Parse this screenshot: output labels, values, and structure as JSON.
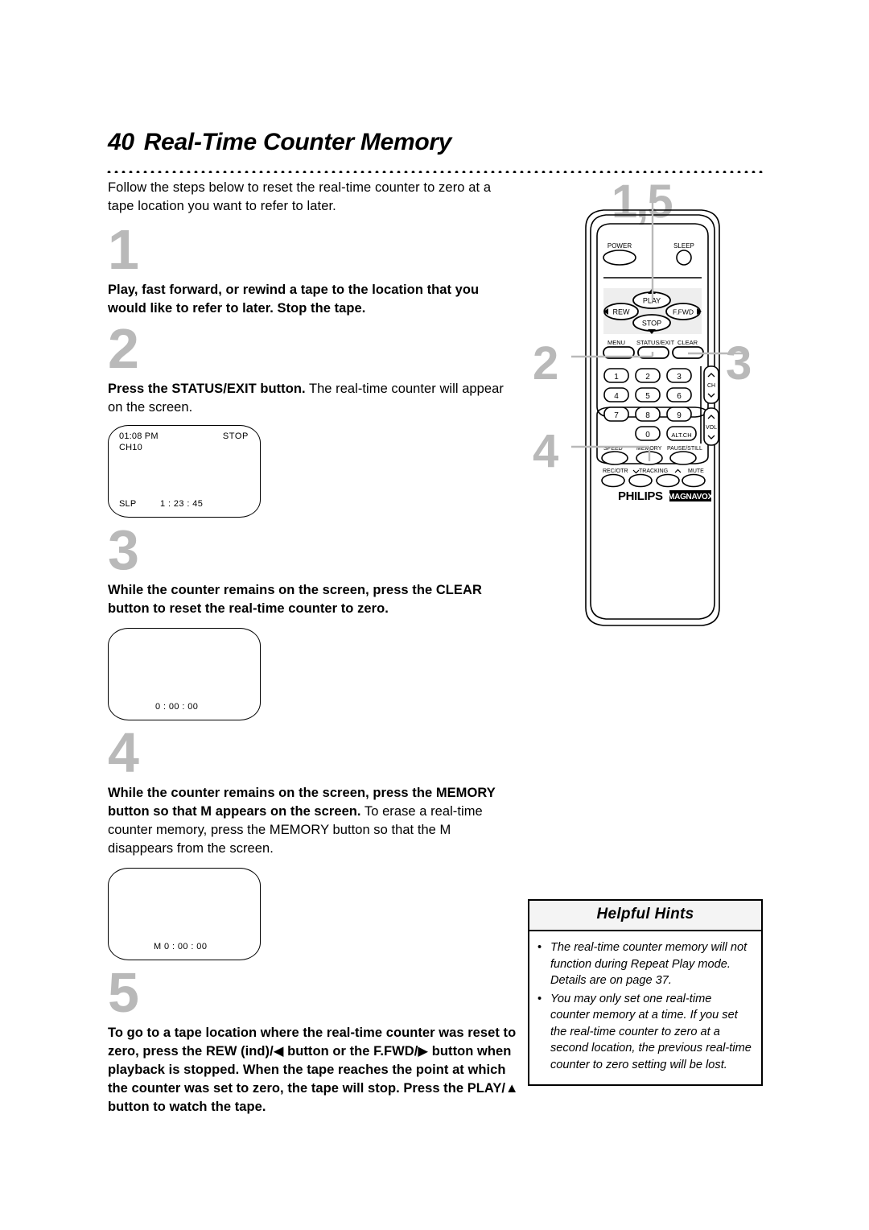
{
  "page": {
    "number": "40",
    "title": "Real-Time Counter Memory",
    "intro": "Follow the steps below to reset the real-time counter to zero at a tape location you want to refer to later."
  },
  "steps": [
    {
      "number": "1",
      "bold": "Play, fast forward, or rewind a tape to the location that you would like to refer to later.  Stop the tape.",
      "rest": ""
    },
    {
      "number": "2",
      "bold": "Press the STATUS/EXIT button.",
      "rest": " The real-time counter will appear on the screen."
    },
    {
      "number": "3",
      "bold": "While the counter remains on the screen, press the CLEAR button to reset the real-time counter to zero.",
      "rest": ""
    },
    {
      "number": "4",
      "bold": "While the counter remains on the screen, press the MEMORY button so that M appears on the screen.",
      "rest": " To erase a real-time counter memory, press the MEMORY button so that the M disappears from the screen."
    },
    {
      "number": "5",
      "bold": "To go to a tape location where the real-time counter was reset to zero, press the REW (ind)/◀ button or the F.FWD/▶ button when playback is stopped. When the tape reaches the point at which the counter was set to zero, the tape will stop. Press the PLAY/▲ button to watch the tape.",
      "rest": ""
    }
  ],
  "screens": {
    "step2": {
      "time": "01:08 PM",
      "mode": "STOP",
      "channel": "CH10",
      "speed": "SLP",
      "counter": "1 : 23 : 45"
    },
    "step3": {
      "counter": "0 : 00 : 00"
    },
    "step4": {
      "counter": "M  0 : 00 : 00"
    }
  },
  "hints": {
    "title": "Helpful Hints",
    "bullet": "•",
    "items": [
      "The real-time counter memory will not function during Repeat Play mode.  Details are on page 37.",
      "You may only set one real-time counter memory at a time. If you set the real-time counter to zero at a second location, the previous real-time counter to zero setting will be lost."
    ]
  },
  "remote": {
    "callouts": {
      "top": "1,5",
      "left_upper": "2",
      "right": "3",
      "left_lower": "4"
    },
    "buttons": {
      "power": "POWER",
      "sleep": "SLEEP",
      "play": "PLAY",
      "stop": "STOP",
      "rew": "REW",
      "ffwd": "F.FWD",
      "menu": "MENU",
      "status_exit": "STATUS/EXIT",
      "clear": "CLEAR",
      "k1": "1",
      "k2": "2",
      "k3": "3",
      "k4": "4",
      "k5": "5",
      "k6": "6",
      "k7": "7",
      "k8": "8",
      "k9": "9",
      "k0": "0",
      "alt_ch": "ALT.CH",
      "ch": "CH",
      "vol": "VOL",
      "speed": "SPEED",
      "memory": "MEMORY",
      "pause_still": "PAUSE/STILL",
      "rec_otr": "REC/OTR",
      "tracking": "TRACKING",
      "mute": "MUTE"
    },
    "brand": "PHILIPS",
    "sub_brand": "MAGNAVOX"
  }
}
